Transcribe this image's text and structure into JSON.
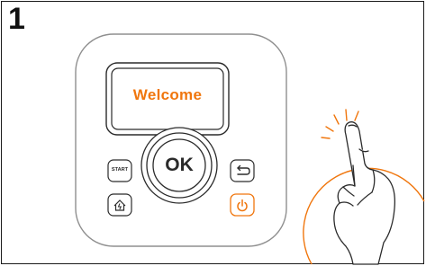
{
  "step": {
    "number": "1"
  },
  "display": {
    "text": "Welcome"
  },
  "keypad": {
    "ok_label": "OK",
    "start_label": "START"
  },
  "icons": {
    "back": "back-arrow-icon",
    "home": "home-station-icon",
    "power": "power-icon",
    "hand": "pointing-hand-icon"
  },
  "colors": {
    "accent": "#f0760d",
    "outline": "#2b2b2b",
    "panel_border": "#9a9a9a"
  }
}
